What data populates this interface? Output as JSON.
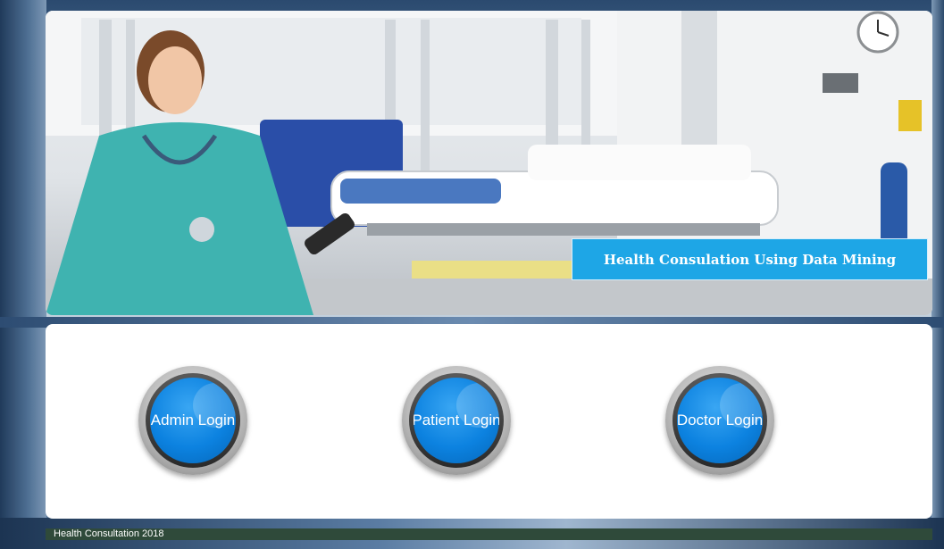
{
  "banner": {
    "title": "Health Consulation Using Data Mining"
  },
  "hero_image": {
    "icon": "hospital-room-nurse-image"
  },
  "logins": [
    {
      "label": "Admin Login",
      "icon": "admin-login-button"
    },
    {
      "label": "Patient Login",
      "icon": "patient-login-button"
    },
    {
      "label": "Doctor Login",
      "icon": "doctor-login-button"
    }
  ],
  "footer": {
    "text": "Health Consultation 2018"
  },
  "colors": {
    "banner_bg": "#1ea6e6",
    "button_blue": "#0c82e0",
    "footer_bg": "#2f4a3a"
  }
}
